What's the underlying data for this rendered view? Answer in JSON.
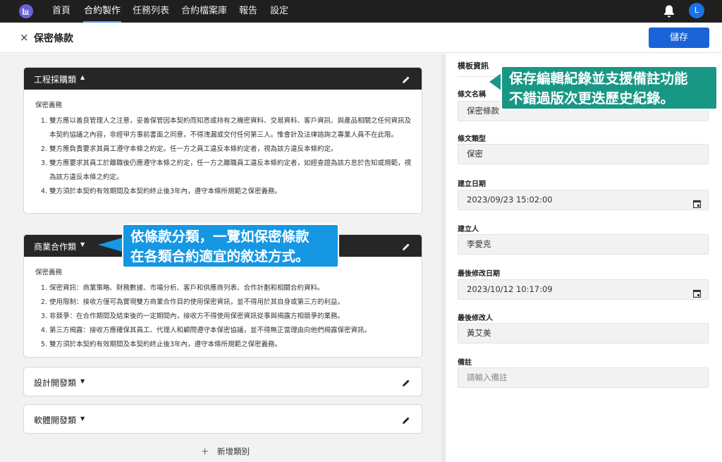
{
  "nav": {
    "items": [
      "首頁",
      "合約製作",
      "任務列表",
      "合約檔案庫",
      "報告",
      "設定"
    ],
    "active_index": 1,
    "avatar_letter": "L"
  },
  "header": {
    "close_symbol": "×",
    "title": "保密條款",
    "save_label": "儲存"
  },
  "categories": [
    {
      "name": "工程採購類",
      "expanded": true,
      "section": "保密義務",
      "items": [
        "雙方應以善良管理人之注意，妥善保管因本契約而知悉或持有之機密資料、交易資料、客戶資訊、與產品相關之任何資訊及本契約協議之內容，非經甲方事前書面之同意，不得洩漏或交付任何第三人。惟會計及法律諮詢之專業人員不在此限。",
        "雙方應負責要求其員工遵守本條之約定。任一方之員工違反本條約定者，視為該方違反本條約定。",
        "雙方應要求其員工於離職後仍應遵守本條之約定，任一方之離職員工違反本條約定者，如經查證為該方怠於告知或規範，視為該方違反本條之約定。",
        "雙方須於本契約有效期間及本契約終止後3年內，遵守本條所規範之保密義務。"
      ]
    },
    {
      "name": "商業合作類",
      "expanded": true,
      "section": "保密義務",
      "items": [
        "保密資訊：商業策略、財務數據、市場分析、客戶和供應商列表、合作計劃和相關合約資料。",
        "使用限制：接收方僅可為實現雙方商業合作目的使用保密資訊，並不得用於其自身或第三方的利益。",
        "非競爭：在合作期間及結束後的一定期間內，接收方不得使用保密資訊從事與揭露方相競爭的業務。",
        "第三方揭露：接收方應確保其員工、代理人和顧問遵守本保密協議，並不得無正當理由向他們揭露保密資訊。",
        "雙方須於本契約有效期間及本契約終止後3年內，遵守本條所規範之保密義務。"
      ]
    },
    {
      "name": "設計開發類",
      "expanded": false
    },
    {
      "name": "軟體開發類",
      "expanded": false
    }
  ],
  "add_category_label": "＋　新增類別",
  "template_info": {
    "title": "模板資訊",
    "fields": [
      {
        "label": "條文名稱",
        "value": "保密條款"
      },
      {
        "label": "條文類型",
        "value": "保密"
      },
      {
        "label": "建立日期",
        "value": "2023/09/23 15:02:00",
        "icon": "calendar-icon"
      },
      {
        "label": "建立人",
        "value": "李愛克"
      },
      {
        "label": "最後修改日期",
        "value": "2023/10/12 10:17:09",
        "icon": "calendar-icon"
      },
      {
        "label": "最後修改人",
        "value": "黃艾美"
      },
      {
        "label": "備註",
        "placeholder": "請輸入備註"
      }
    ]
  },
  "callouts": {
    "right_line1": "保存編輯紀錄並支援備註功能",
    "right_line2": "不錯過版次更迭歷史紀錄。",
    "left_line1": "依條款分類，一覽如保密條款",
    "left_line2": "在各類合約適宜的敘述方式。"
  },
  "colors": {
    "nav_bg": "#1f1f1f",
    "primary": "#1a63d6",
    "callout_teal": "#199785",
    "callout_blue": "#1597e3"
  }
}
